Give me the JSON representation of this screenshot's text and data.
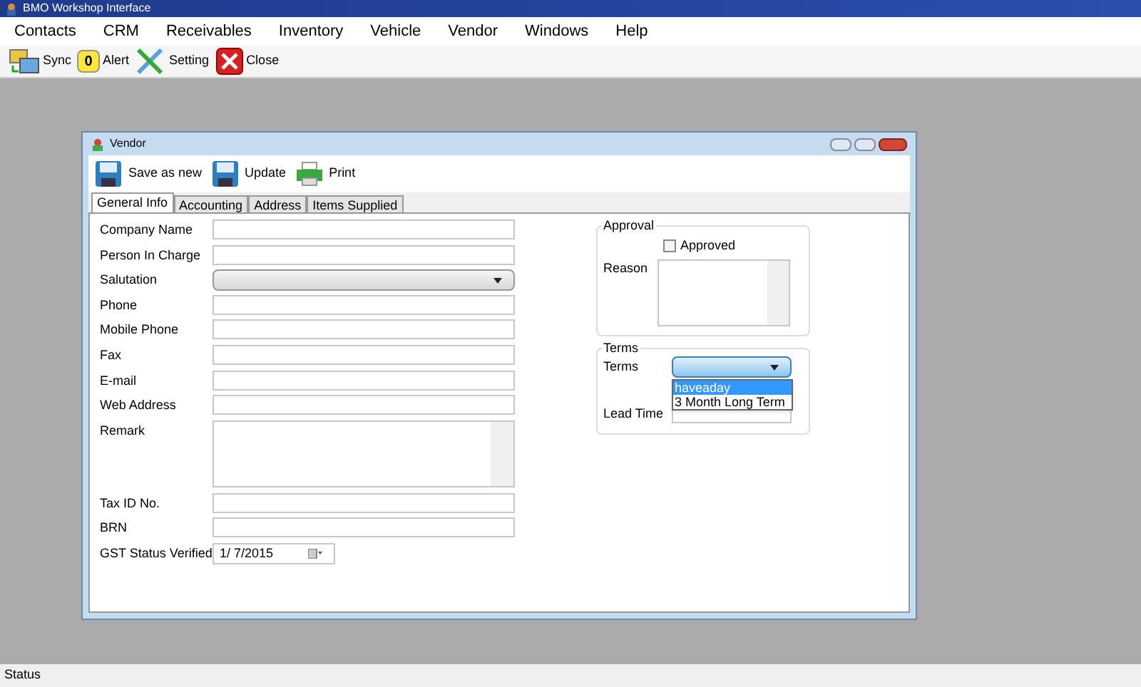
{
  "app": {
    "title": "BMO Workshop Interface"
  },
  "menu": [
    "Contacts",
    "CRM",
    "Receivables",
    "Inventory",
    "Vehicle",
    "Vendor",
    "Windows",
    "Help"
  ],
  "toolbar": [
    {
      "kind": "sync",
      "label": "Sync"
    },
    {
      "kind": "alert",
      "label": "Alert",
      "count": "0"
    },
    {
      "kind": "setting",
      "label": "Setting"
    },
    {
      "kind": "close",
      "label": "Close"
    }
  ],
  "window": {
    "title": "Vendor",
    "toolbar": [
      {
        "kind": "save",
        "label": "Save as new"
      },
      {
        "kind": "save",
        "label": "Update"
      },
      {
        "kind": "print",
        "label": "Print"
      }
    ],
    "tabs": [
      {
        "label": "General Info",
        "selected": true
      },
      {
        "label": "Accounting",
        "selected": false
      },
      {
        "label": "Address",
        "selected": false
      },
      {
        "label": "Items Supplied",
        "selected": false
      }
    ],
    "fields": [
      {
        "kind": "text",
        "label": "Company Name"
      },
      {
        "kind": "text",
        "label": "Person In Charge"
      },
      {
        "kind": "combo",
        "label": "Salutation"
      },
      {
        "kind": "text",
        "label": "Phone"
      },
      {
        "kind": "text",
        "label": "Mobile Phone"
      },
      {
        "kind": "text",
        "label": "Fax"
      },
      {
        "kind": "text",
        "label": "E-mail"
      },
      {
        "kind": "text",
        "label": "Web Address"
      },
      {
        "kind": "memo",
        "label": "Remark"
      },
      {
        "kind": "text",
        "label": "Tax ID No."
      },
      {
        "kind": "text",
        "label": "BRN"
      },
      {
        "kind": "date",
        "label": "GST Status Verified",
        "value": "1/  7/2015"
      }
    ],
    "approval": {
      "title": "Approval",
      "checkbox": {
        "label": "Approved",
        "checked": false
      },
      "reason_label": "Reason"
    },
    "terms": {
      "title": "Terms",
      "terms_label": "Terms",
      "expanded": true,
      "options": [
        {
          "label": "haveaday",
          "selected": true
        },
        {
          "label": "3 Month Long Term",
          "selected": false
        }
      ],
      "lead_time_label": "Lead Time"
    }
  },
  "status_bar": "Status"
}
